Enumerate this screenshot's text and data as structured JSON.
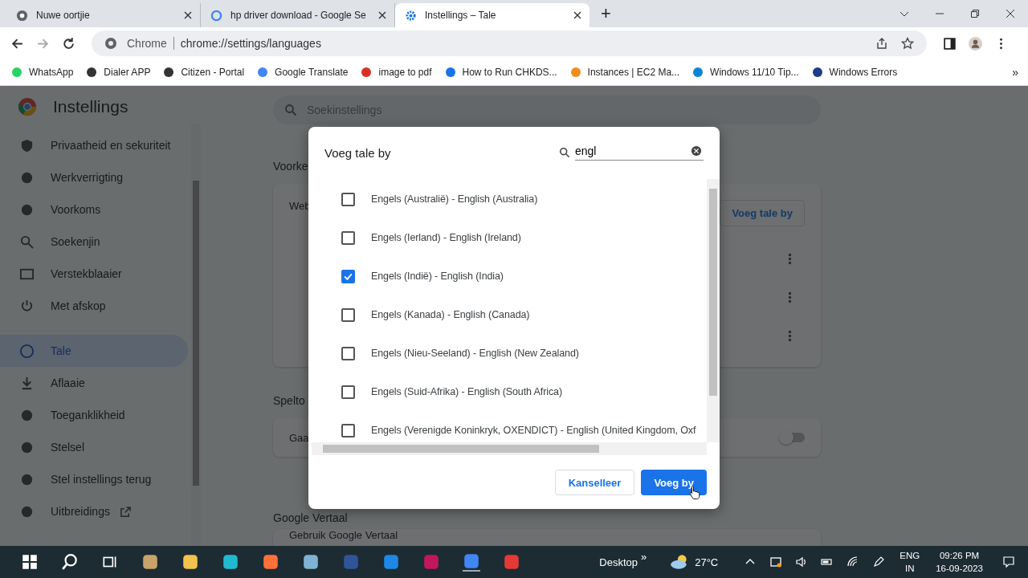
{
  "browser": {
    "tabs": [
      {
        "title": "Nuwe oortjie",
        "selected": false
      },
      {
        "title": "hp driver download - Google Se",
        "selected": false
      },
      {
        "title": "Instellings – Tale",
        "selected": true
      }
    ],
    "new_tab": "+",
    "address": {
      "site": "Chrome",
      "url": "chrome://settings/languages"
    },
    "bookmarks": [
      "WhatsApp",
      "Dialer APP",
      "Citizen - Portal",
      "Google Translate",
      "image to pdf",
      "How to Run CHKDS...",
      "Instances | EC2 Ma...",
      "Windows 11/10 Tip...",
      "Windows Errors"
    ],
    "bookmarks_more": "»"
  },
  "settings": {
    "title": "Instellings",
    "search": {
      "placeholder": "Soekinstellings"
    },
    "sidebar": [
      {
        "label": "Privaatheid en sekuriteit",
        "selected": false
      },
      {
        "label": "Werkverrigting",
        "selected": false
      },
      {
        "label": "Voorkoms",
        "selected": false
      },
      {
        "label": "Soekenjin",
        "selected": false
      },
      {
        "label": "Verstekblaaier",
        "selected": false
      },
      {
        "label": "Met afskop",
        "selected": false
      },
      {
        "label": "Tale",
        "selected": true
      },
      {
        "label": "Aflaaie",
        "selected": false
      },
      {
        "label": "Toeganklikheid",
        "selected": false
      },
      {
        "label": "Stelsel",
        "selected": false
      },
      {
        "label": "Stel instellings terug",
        "selected": false
      },
      {
        "label": "Uitbreidings",
        "selected": false
      }
    ],
    "sections": [
      {
        "heading": "Voorke",
        "kind": "languages",
        "card_label": "Web",
        "button": "Voeg tale by"
      },
      {
        "heading": "Spelto",
        "kind": "toggle",
        "row_label": "Gaa",
        "on": false
      },
      {
        "heading": "Google Vertaal",
        "kind": "row",
        "row_label": "Gebruik Google Vertaal"
      }
    ]
  },
  "dialog": {
    "title": "Voeg tale by",
    "search": {
      "value": "engl"
    },
    "languages": [
      {
        "label": "Engels (Australië) - English (Australia)",
        "checked": false
      },
      {
        "label": "Engels (Ierland) - English (Ireland)",
        "checked": false
      },
      {
        "label": "Engels (Indië) - English (India)",
        "checked": true
      },
      {
        "label": "Engels (Kanada) - English (Canada)",
        "checked": false
      },
      {
        "label": "Engels (Nieu-Seeland) - English (New Zealand)",
        "checked": false
      },
      {
        "label": "Engels (Suid-Afrika) - English (South Africa)",
        "checked": false
      },
      {
        "label": "Engels (Verenigde Koninkryk, OXENDICT) - English (United Kingdom, Oxf",
        "checked": false
      }
    ],
    "buttons": [
      {
        "label": "Kanselleer",
        "kind": "secondary"
      },
      {
        "label": "Voeg by",
        "kind": "primary"
      }
    ]
  },
  "taskbar": {
    "desktop": "Desktop",
    "more": "»",
    "weather": "27°C",
    "language": "ENG",
    "region": "IN",
    "time": "09:26 PM",
    "date": "16-09-2023"
  }
}
